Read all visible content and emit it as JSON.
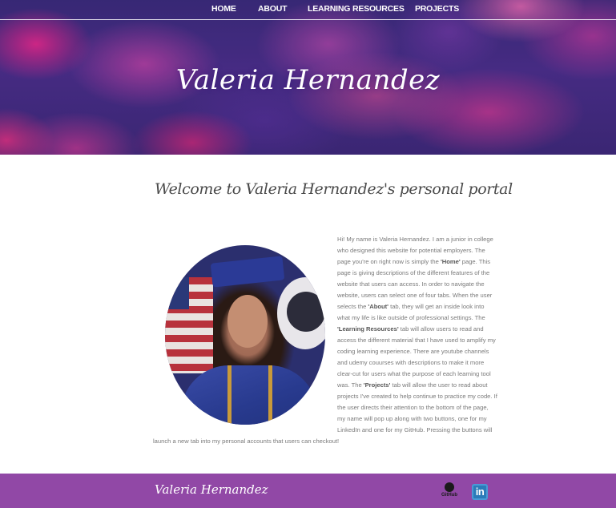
{
  "nav": {
    "items": [
      {
        "label": "HOME"
      },
      {
        "label": "ABOUT"
      },
      {
        "label": "LEARNING RESOURCES"
      },
      {
        "label": "PROJECTS"
      }
    ]
  },
  "hero": {
    "name": "Valeria Hernandez"
  },
  "main": {
    "welcome_heading": "Welcome to Valeria Hernandez's personal portal",
    "photo_alt": "Valeria Hernandez graduation photo",
    "bio": {
      "p1": "Hi! My name is Valeria Hernandez. I am a junior in college who designed this website for potential employers. The page you're on right now is simply the ",
      "home_tab": "'Home'",
      "p2": " page. This page is giving descriptions of the different features of the website that users can access. In order to navigate the website, users can select one of four tabs. When the user selects the ",
      "about_tab": "'About'",
      "p3": " tab, they will get an inside look into what my life is like outside of professional settings. The ",
      "learning_tab": "'Learning Resources'",
      "p4": " tab will allow users to read and access the different material that I have used to amplify my coding learning experience. There are youtube channels and udemy couurses with descriptions to make it more clear-cut for users what the purpose of each learning tool was. The ",
      "projects_tab": "'Projects'",
      "p5": " tab will allow the user to read about projects I've created to help continue to practice my code. If the user directs their attention to the bottom of the page, my name will pop up along with two buttons, one for my LinkedIn and one for my GitHub. Pressing the buttons will launch a new tab into my personal accounts that users can checkout!"
    }
  },
  "footer": {
    "name": "Valeria Hernandez",
    "github_label": "GitHub",
    "linkedin_label": "in"
  },
  "icons": {
    "github": "github-icon",
    "linkedin": "linkedin-icon"
  },
  "colors": {
    "footer_bg": "#9148a6",
    "linkedin_blue": "#2b7bb9",
    "text_gray": "#7a7a7a"
  }
}
